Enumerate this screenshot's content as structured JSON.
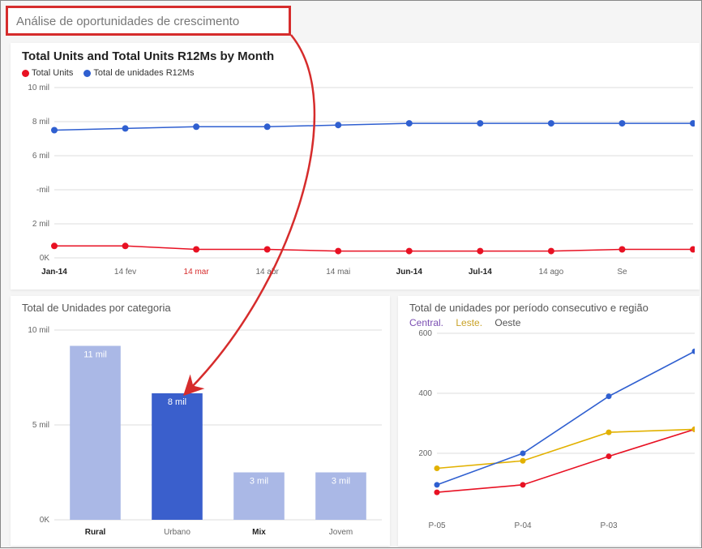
{
  "page_title": "Análise de oportunidades de crescimento",
  "top_chart": {
    "title": "Total Units and Total Units R12Ms by Month",
    "legend": [
      {
        "label": "Total Units",
        "color": "#e81123"
      },
      {
        "label": "Total de unidades R12Ms",
        "color": "#2f5fd0"
      }
    ],
    "y_ticks": [
      "0K",
      "2 mil",
      "-mil",
      "6 mil",
      "8 mil",
      "10 mil"
    ],
    "x_labels": [
      "Jan-14",
      "14 fev",
      "14 mar",
      "14 abr",
      "14 mai",
      "Jun-14",
      "Jul-14",
      "14 ago",
      "Se"
    ],
    "highlight_x_index": 2
  },
  "bl_chart": {
    "title": "Total de Unidades por categoria",
    "y_ticks": [
      "0K",
      "5 mil",
      "10 mil"
    ],
    "categories": [
      "Rural",
      "Urbano",
      "Mix",
      "Jovem"
    ],
    "bar_labels": [
      "11 mil",
      "8 mil",
      "3 mil",
      "3 mil"
    ],
    "highlight_index": 1
  },
  "br_chart": {
    "title": "Total de unidades por período consecutivo e região",
    "regions": [
      {
        "label": "Central.",
        "color": "#7b4fb3"
      },
      {
        "label": "Leste.",
        "color": "#c9a227"
      },
      {
        "label": "Oeste",
        "color": "#555"
      }
    ],
    "y_ticks": [
      "200",
      "400",
      "600"
    ],
    "x_labels": [
      "P-05",
      "P-04",
      "P-03"
    ]
  },
  "chart_data": [
    {
      "type": "line",
      "title": "Total Units and Total Units R12Ms by Month",
      "xlabel": "",
      "ylabel": "",
      "ylim": [
        0,
        10000
      ],
      "categories": [
        "Jan-14",
        "14 fev",
        "14 mar",
        "14 abr",
        "14 mai",
        "Jun-14",
        "Jul-14",
        "14 ago",
        "Se"
      ],
      "series": [
        {
          "name": "Total Units",
          "color": "#e81123",
          "values": [
            700,
            700,
            500,
            500,
            400,
            400,
            400,
            400,
            500,
            500
          ]
        },
        {
          "name": "Total de unidades R12Ms",
          "color": "#2f5fd0",
          "values": [
            7500,
            7600,
            7700,
            7700,
            7800,
            7900,
            7900,
            7900,
            7900,
            7900
          ]
        }
      ]
    },
    {
      "type": "bar",
      "title": "Total de Unidades por categoria",
      "xlabel": "",
      "ylabel": "",
      "ylim": [
        0,
        12000
      ],
      "categories": [
        "Rural",
        "Urbano",
        "Mix",
        "Jovem"
      ],
      "values": [
        11000,
        8000,
        3000,
        3000
      ]
    },
    {
      "type": "line",
      "title": "Total de unidades por período consecutivo e região",
      "xlabel": "",
      "ylabel": "",
      "ylim": [
        0,
        600
      ],
      "categories": [
        "P-05",
        "P-04",
        "P-03"
      ],
      "series": [
        {
          "name": "Central",
          "color": "#e81123",
          "values": [
            70,
            95,
            190,
            280
          ]
        },
        {
          "name": "Leste",
          "color": "#e2b100",
          "values": [
            150,
            175,
            270,
            280
          ]
        },
        {
          "name": "Oeste",
          "color": "#2f5fd0",
          "values": [
            95,
            200,
            390,
            540
          ]
        }
      ]
    }
  ]
}
